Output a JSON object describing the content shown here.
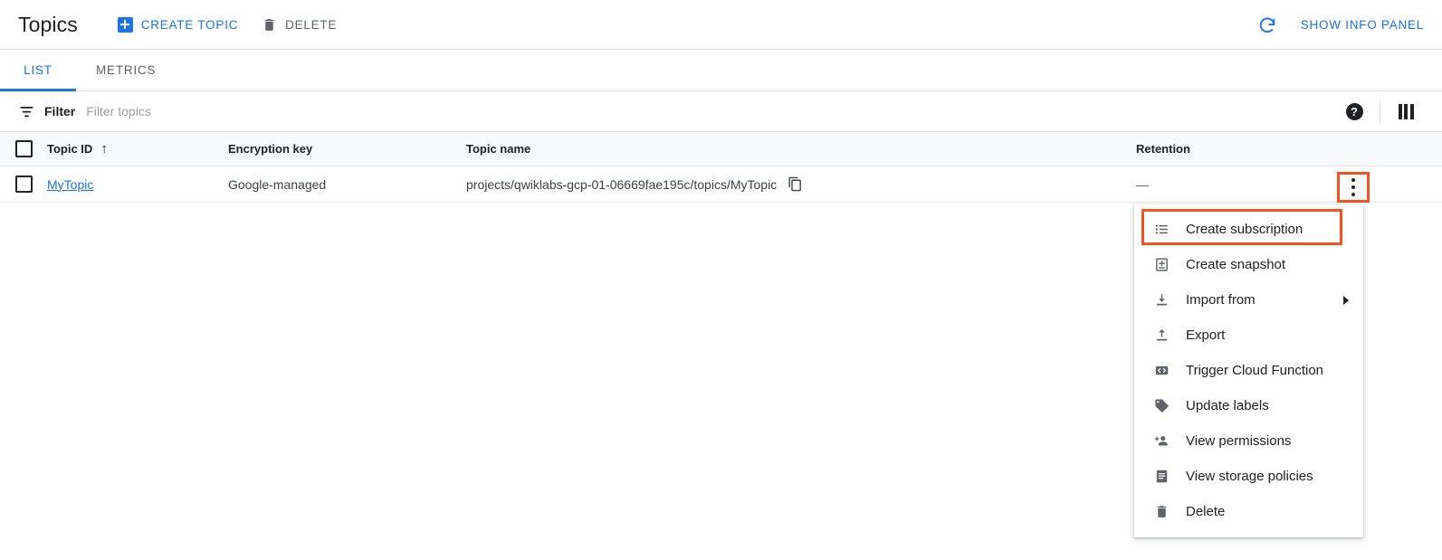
{
  "header": {
    "title": "Topics",
    "create_topic_label": "CREATE TOPIC",
    "delete_label": "DELETE",
    "refresh_icon": "refresh-icon",
    "show_info_panel_label": "SHOW INFO PANEL"
  },
  "tabs": [
    {
      "label": "LIST",
      "active": true
    },
    {
      "label": "METRICS",
      "active": false
    }
  ],
  "filter": {
    "label": "Filter",
    "placeholder": "Filter topics",
    "value": "",
    "help_icon": "help-icon",
    "columns_icon": "column-display-options-icon"
  },
  "table": {
    "columns": [
      "Topic ID",
      "Encryption key",
      "Topic name",
      "Retention"
    ],
    "sort_column": "Topic ID",
    "sort_direction": "ascending",
    "sort_arrow": "↑",
    "rows": [
      {
        "selected": false,
        "topic_id": "MyTopic",
        "encryption_key": "Google-managed",
        "topic_name": "projects/qwiklabs-gcp-01-06669fae195c/topics/MyTopic",
        "copy_icon": "copy-icon",
        "retention": "—",
        "row_menu_icon": "more-vert-icon"
      }
    ]
  },
  "row_menu": {
    "items": [
      {
        "label": "Create subscription",
        "icon": "list-icon",
        "highlighted": true,
        "submenu": false
      },
      {
        "label": "Create snapshot",
        "icon": "snapshot-icon",
        "highlighted": false,
        "submenu": false
      },
      {
        "label": "Import from",
        "icon": "import-icon",
        "highlighted": false,
        "submenu": true
      },
      {
        "label": "Export",
        "icon": "export-icon",
        "highlighted": false,
        "submenu": false
      },
      {
        "label": "Trigger Cloud Function",
        "icon": "code-icon",
        "highlighted": false,
        "submenu": false
      },
      {
        "label": "Update labels",
        "icon": "label-icon",
        "highlighted": false,
        "submenu": false
      },
      {
        "label": "View permissions",
        "icon": "person-add-icon",
        "highlighted": false,
        "submenu": false
      },
      {
        "label": "View storage policies",
        "icon": "storage-policy-icon",
        "highlighted": false,
        "submenu": false
      },
      {
        "label": "Delete",
        "icon": "trash-icon",
        "highlighted": false,
        "submenu": false
      }
    ]
  },
  "colors": {
    "accent_blue": "#1a73e8",
    "highlight_orange": "#f4511e",
    "text_primary": "#202124",
    "text_secondary": "#5f6368",
    "header_row_bg": "#f8f9fa",
    "divider": "#e0e0e0"
  }
}
